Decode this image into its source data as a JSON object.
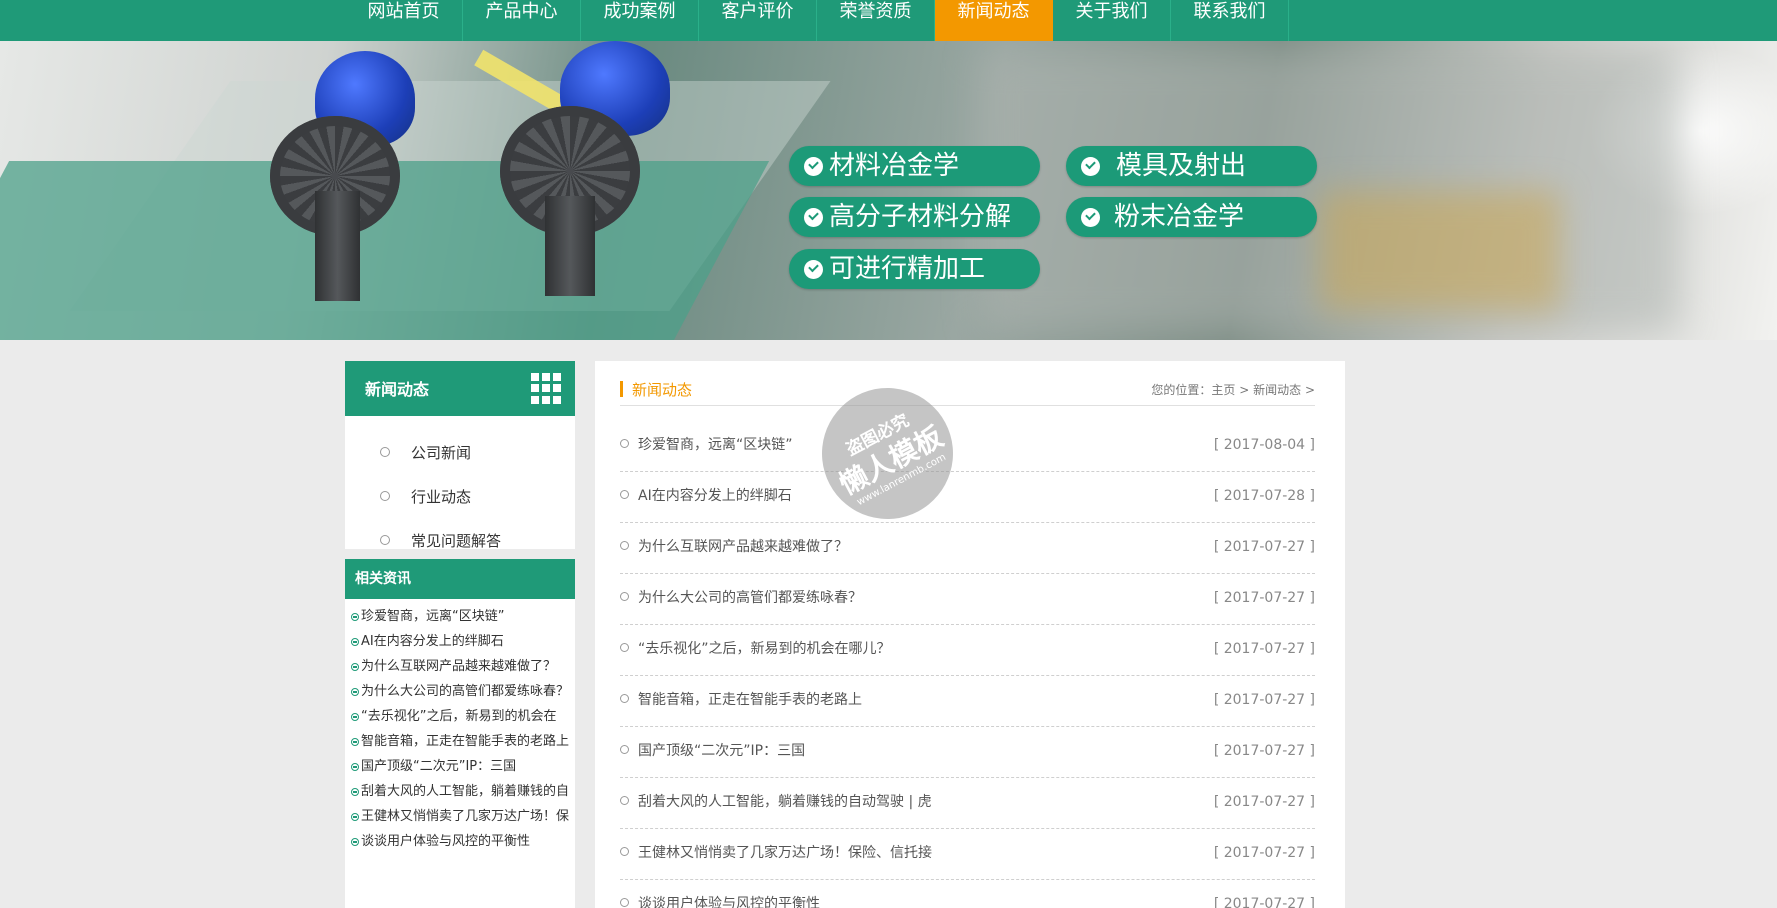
{
  "nav": {
    "items": [
      {
        "label": "网站首页"
      },
      {
        "label": "产品中心"
      },
      {
        "label": "成功案例"
      },
      {
        "label": "客户评价"
      },
      {
        "label": "荣誉资质"
      },
      {
        "label": "新闻动态",
        "active": true
      },
      {
        "label": "关于我们"
      },
      {
        "label": "联系我们"
      }
    ]
  },
  "banner": {
    "tags": [
      "材料冶金学",
      "模具及射出",
      "高分子材料分解",
      "粉末冶金学",
      "可进行精加工"
    ]
  },
  "sidebar": {
    "title": "新闻动态",
    "items": [
      "公司新闻",
      "行业动态",
      "常见问题解答"
    ],
    "related_title": "相关资讯",
    "related": [
      "珍爱智商，远离“区块链”",
      "AI在内容分发上的绊脚石",
      "为什么互联网产品越来越难做了？",
      "为什么大公司的高管们都爱练咏春？",
      "“去乐视化”之后，新易到的机会在",
      "智能音箱，正走在智能手表的老路上",
      "国产顶级“二次元”IP：三国",
      "刮着大风的人工智能，躺着赚钱的自",
      "王健林又悄悄卖了几家万达广场！保",
      "谈谈用户体验与风控的平衡性"
    ]
  },
  "main": {
    "title": "新闻动态",
    "breadcrumb": {
      "prefix": "您的位置：",
      "home": "主页",
      "sep1": " > ",
      "current": "新闻动态",
      "sep2": " >"
    },
    "news": [
      {
        "title": "珍爱智商，远离“区块链”",
        "date": "[ 2017-08-04 ]"
      },
      {
        "title": "AI在内容分发上的绊脚石",
        "date": "[ 2017-07-28 ]"
      },
      {
        "title": "为什么互联网产品越来越难做了？",
        "date": "[ 2017-07-27 ]"
      },
      {
        "title": "为什么大公司的高管们都爱练咏春？",
        "date": "[ 2017-07-27 ]"
      },
      {
        "title": "“去乐视化”之后，新易到的机会在哪儿？",
        "date": "[ 2017-07-27 ]"
      },
      {
        "title": "智能音箱，正走在智能手表的老路上",
        "date": "[ 2017-07-27 ]"
      },
      {
        "title": "国产顶级“二次元”IP：三国",
        "date": "[ 2017-07-27 ]"
      },
      {
        "title": "刮着大风的人工智能，躺着赚钱的自动驾驶 | 虎",
        "date": "[ 2017-07-27 ]"
      },
      {
        "title": "王健林又悄悄卖了几家万达广场！保险、信托接",
        "date": "[ 2017-07-27 ]"
      },
      {
        "title": "谈谈用户体验与风控的平衡性",
        "date": "[ 2017-07-27 ]"
      }
    ]
  },
  "watermark": {
    "line1": "盗图必究",
    "line2": "懒人模板",
    "line3": "www.lanrenmb.com"
  },
  "colors": {
    "brand_green": "#1f9a78",
    "accent_orange": "#f39800"
  }
}
